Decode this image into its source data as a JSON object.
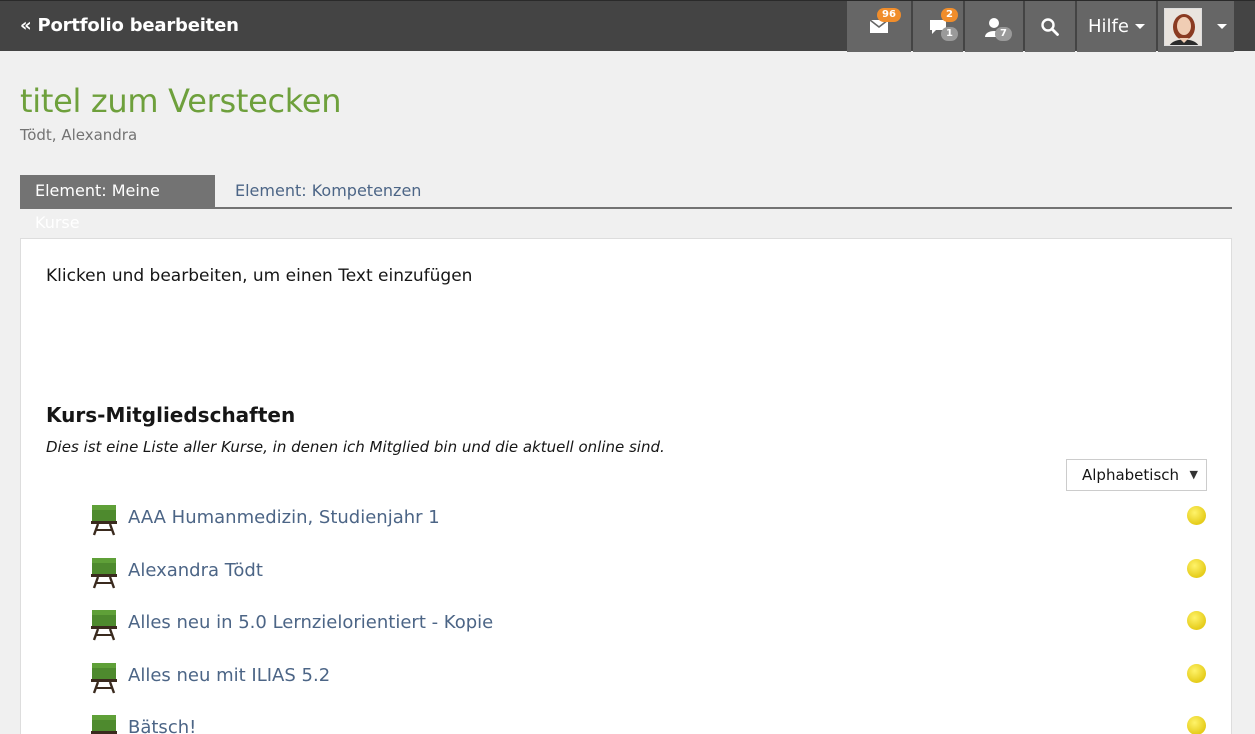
{
  "topbar": {
    "back_label": "« Portfolio bearbeiten",
    "mail_badge": "96",
    "chat_badge_new": "2",
    "chat_badge_count": "1",
    "users_badge": "7",
    "help_label": "Hilfe"
  },
  "page": {
    "title": "titel zum Verstecken",
    "author": "Tödt, Alexandra"
  },
  "tabs": [
    {
      "label": "Element: Meine Kurse",
      "active": true
    },
    {
      "label": "Element: Kompetenzen",
      "active": false
    }
  ],
  "content": {
    "intro_text": "Klicken und bearbeiten, um einen Text einzufügen",
    "section_title": "Kurs-Mitgliedschaften",
    "section_desc": "Dies ist eine Liste aller Kurse, in denen ich Mitglied bin und die aktuell online sind.",
    "sort_value": "Alphabetisch",
    "courses": [
      {
        "label": "AAA Humanmedizin, Studienjahr 1",
        "status": "online"
      },
      {
        "label": "Alexandra Tödt",
        "status": "online"
      },
      {
        "label": "Alles neu in 5.0 Lernzielorientiert - Kopie",
        "status": "online"
      },
      {
        "label": "Alles neu mit ILIAS 5.2",
        "status": "online"
      },
      {
        "label": "Bätsch!",
        "status": "online"
      }
    ]
  },
  "colors": {
    "title_green": "#6ea03c",
    "link_blue": "#4c6586",
    "topbar": "#444444",
    "badge_orange": "#f08d2b"
  }
}
